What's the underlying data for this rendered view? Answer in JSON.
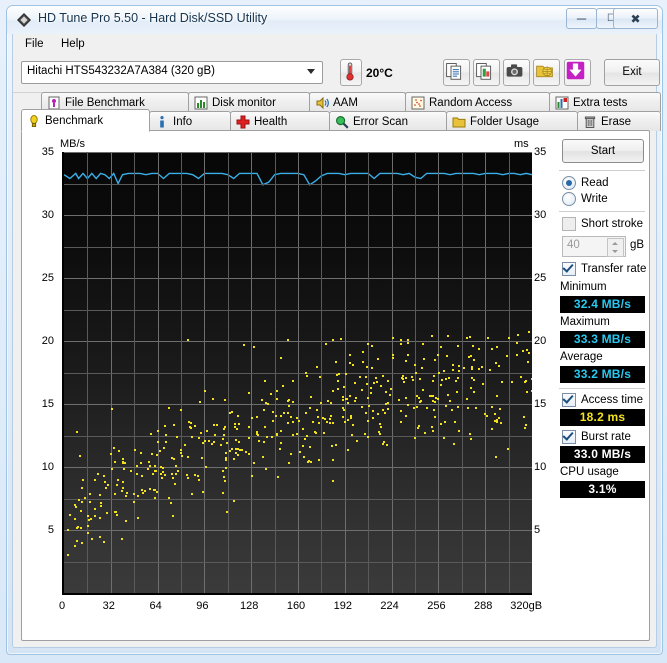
{
  "window": {
    "title": "HD Tune Pro 5.50 - Hard Disk/SSD Utility",
    "icon": "hdtune-diamond-icon",
    "buttons": {
      "minimize": "–",
      "maximize": "❐",
      "close": "✕"
    }
  },
  "menu": {
    "items": [
      {
        "label": "File",
        "accel": "F"
      },
      {
        "label": "Help",
        "accel": "H"
      }
    ]
  },
  "toolbar": {
    "drive": {
      "value": "Hitachi HTS543232A7A384 (320 gB)",
      "icon": "chevron-down-icon"
    },
    "temperature": {
      "icon": "thermometer-icon",
      "value": "20°C"
    },
    "icons": [
      "copy-text-icon",
      "copy-image-icon",
      "screenshot-camera-icon",
      "folder-globe-icon",
      "download-arrow-icon"
    ],
    "exit_label": "Exit"
  },
  "tabs": {
    "top_row": [
      {
        "label": "File Benchmark",
        "icon": "file-benchmark-icon",
        "active": false
      },
      {
        "label": "Disk monitor",
        "icon": "bar-chart-icon",
        "active": false
      },
      {
        "label": "AAM",
        "icon": "speaker-icon",
        "active": false
      },
      {
        "label": "Random Access",
        "icon": "scatter-icon",
        "active": false
      },
      {
        "label": "Extra tests",
        "icon": "extra-chart-icon",
        "active": false
      }
    ],
    "bottom_row": [
      {
        "label": "Benchmark",
        "icon": "bulb-icon",
        "active": true
      },
      {
        "label": "Info",
        "icon": "info-icon",
        "active": false
      },
      {
        "label": "Health",
        "icon": "red-cross-icon",
        "active": false
      },
      {
        "label": "Error Scan",
        "icon": "magnifier-icon",
        "active": false
      },
      {
        "label": "Folder Usage",
        "icon": "folder-icon",
        "active": false
      },
      {
        "label": "Erase",
        "icon": "trash-icon",
        "active": false
      }
    ]
  },
  "sidebar": {
    "start_label": "Start",
    "mode": {
      "read": {
        "label": "Read",
        "selected": true
      },
      "write": {
        "label": "Write",
        "selected": false
      }
    },
    "short_stroke": {
      "label": "Short stroke",
      "checked": false
    },
    "short_stroke_value": "40",
    "short_stroke_unit": "gB",
    "transfer_rate": {
      "label": "Transfer rate",
      "checked": true
    },
    "results": [
      {
        "label": "Minimum",
        "value": "32.4 MB/s",
        "color": "#28c8f0"
      },
      {
        "label": "Maximum",
        "value": "33.3 MB/s",
        "color": "#28c8f0"
      },
      {
        "label": "Average",
        "value": "33.2 MB/s",
        "color": "#28c8f0"
      }
    ],
    "access_time": {
      "label": "Access time",
      "checked": true,
      "value": "18.2 ms",
      "color": "#f2e21c"
    },
    "burst_rate": {
      "label": "Burst rate",
      "checked": true,
      "value": "33.0 MB/s",
      "color": "#ffffff"
    },
    "cpu_usage": {
      "label": "CPU usage",
      "value": "3.1%",
      "color": "#ffffff"
    }
  },
  "chart_data": {
    "type": "scatter",
    "title": "",
    "xlabel": "320gB",
    "ylabel": "MB/s",
    "ylabel_right": "ms",
    "xlim": [
      0,
      320
    ],
    "ylim": [
      0,
      35
    ],
    "grid": true,
    "x_ticks": [
      "0",
      "32",
      "64",
      "96",
      "128",
      "160",
      "192",
      "224",
      "256",
      "288",
      "320gB"
    ],
    "x_tick_values": [
      0,
      32,
      64,
      96,
      128,
      160,
      192,
      224,
      256,
      288,
      320
    ],
    "y_ticks_left": [
      "5",
      "10",
      "15",
      "20",
      "25",
      "30",
      "35"
    ],
    "y_ticks_right": [
      "5",
      "10",
      "15",
      "20",
      "25",
      "30",
      "35"
    ],
    "y_tick_values": [
      5,
      10,
      15,
      20,
      25,
      30,
      35
    ],
    "series": [
      {
        "name": "Transfer rate",
        "type": "line",
        "color": "#3ab0e8",
        "unit": "MB/s",
        "axis": "left",
        "x": [
          0,
          4,
          8,
          10,
          13,
          16,
          19,
          22,
          25,
          28,
          31,
          34,
          37,
          40,
          44,
          48,
          52,
          56,
          60,
          64,
          68,
          72,
          76,
          80,
          84,
          88,
          92,
          96,
          100,
          104,
          108,
          112,
          116,
          120,
          124,
          128,
          132,
          136,
          140,
          144,
          148,
          152,
          156,
          160,
          164,
          168,
          172,
          176,
          180,
          184,
          188,
          192,
          196,
          200,
          204,
          208,
          212,
          216,
          220,
          224,
          228,
          232,
          236,
          240,
          244,
          248,
          252,
          256,
          260,
          264,
          268,
          272,
          276,
          280,
          284,
          288,
          292,
          296,
          300,
          304,
          308,
          312,
          316,
          320
        ],
        "y": [
          33.2,
          32.9,
          33.3,
          32.9,
          33.3,
          32.9,
          33.3,
          32.9,
          33.3,
          33.2,
          32.9,
          33.3,
          32.5,
          33.2,
          33.3,
          33.3,
          33.3,
          33.2,
          33.3,
          33.3,
          32.9,
          33.3,
          33.3,
          33.3,
          33.3,
          33.2,
          32.9,
          33.3,
          33.3,
          33.3,
          33.3,
          33.2,
          32.9,
          33.3,
          33.3,
          33.3,
          33.3,
          32.4,
          32.6,
          33.2,
          33.3,
          33.3,
          33.3,
          33.3,
          33.2,
          32.4,
          32.7,
          33.1,
          33.3,
          33.3,
          33.3,
          33.2,
          33.3,
          33.3,
          33.3,
          33.3,
          32.9,
          33.3,
          33.3,
          33.3,
          33.3,
          33.2,
          33.3,
          33.0,
          32.9,
          33.3,
          33.3,
          33.3,
          33.3,
          33.2,
          33.3,
          33.3,
          33.3,
          33.3,
          33.2,
          33.3,
          33.3,
          33.3,
          33.2,
          33.3,
          33.3,
          33.2,
          33.3,
          33.2
        ]
      },
      {
        "name": "Access time",
        "type": "scatter",
        "color": "#f2e21c",
        "unit": "ms",
        "axis": "right",
        "point_count": 520,
        "description": "Access time samples rising from ~4 ms near 0 gB to ~20 ms near 320 gB",
        "average": 18.2
      }
    ],
    "summary": {
      "minimum": 32.4,
      "maximum": 33.3,
      "average": 33.2,
      "access_time": 18.2,
      "burst_rate": 33.0,
      "cpu_usage": 3.1
    }
  }
}
